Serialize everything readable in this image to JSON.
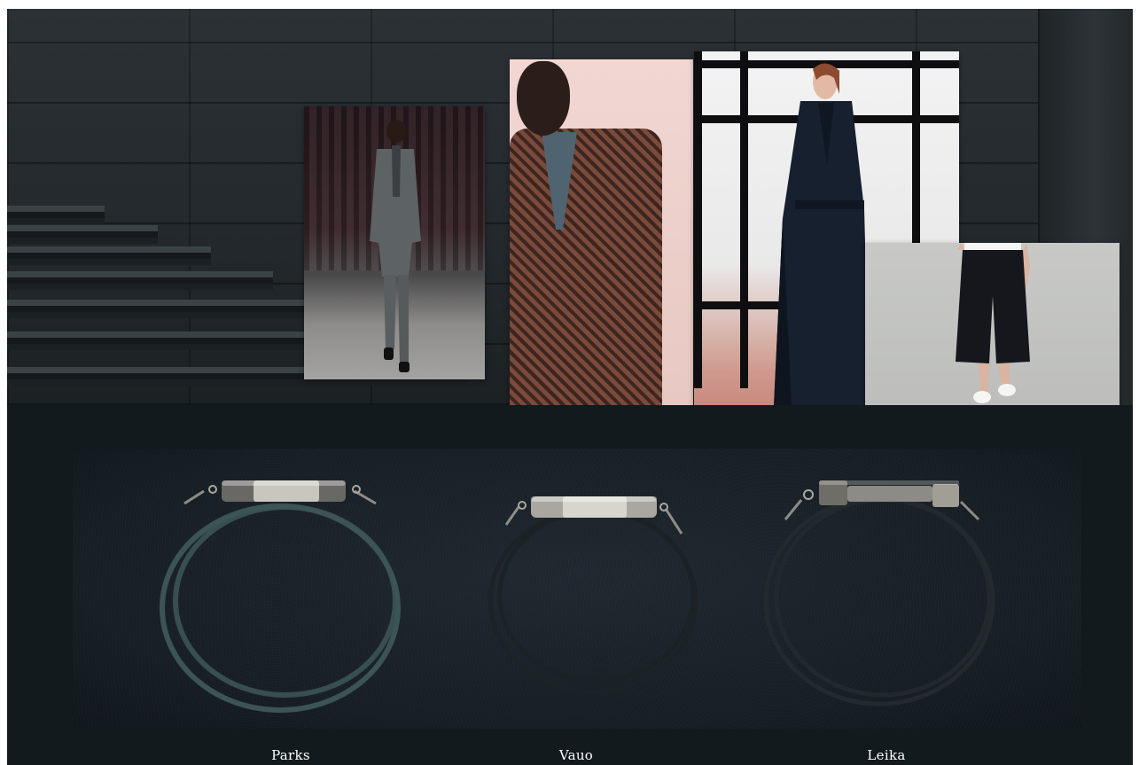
{
  "moodboard": {
    "photos": [
      {
        "subject": "runway-grey-suit"
      },
      {
        "subject": "herringbone-coat"
      },
      {
        "subject": "navy-wrap-coat"
      },
      {
        "subject": "black-culottes"
      }
    ]
  },
  "bracelets": [
    {
      "name": "Parks",
      "cord_color": "#3c5455",
      "clasp": "cylinder"
    },
    {
      "name": "Vauo",
      "cord_color": "#1c2226",
      "clasp": "cylinder"
    },
    {
      "name": "Leika",
      "cord_color": "#23292d",
      "clasp": "square-bar"
    }
  ],
  "colors": {
    "page_background": "#121a1d",
    "caption_text": "#ffffff",
    "metal": "#b9b7b0"
  }
}
